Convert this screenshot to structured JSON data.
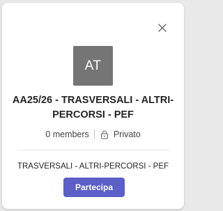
{
  "card": {
    "avatar_initials": "AT",
    "title": "AA25/26 - TRASVERSALI - ALTRI-PERCORSI - PEF",
    "members": "0 members",
    "privacy": "Privato",
    "description": "TRASVERSALI - ALTRI-PERCORSI - PEF",
    "join_label": "Partecipa",
    "close_icon": "close-icon",
    "privacy_icon": "lock-icon"
  },
  "colors": {
    "avatar_bg": "#757575",
    "primary_button": "#5b5fc7",
    "backdrop": "#e9e9e9"
  }
}
